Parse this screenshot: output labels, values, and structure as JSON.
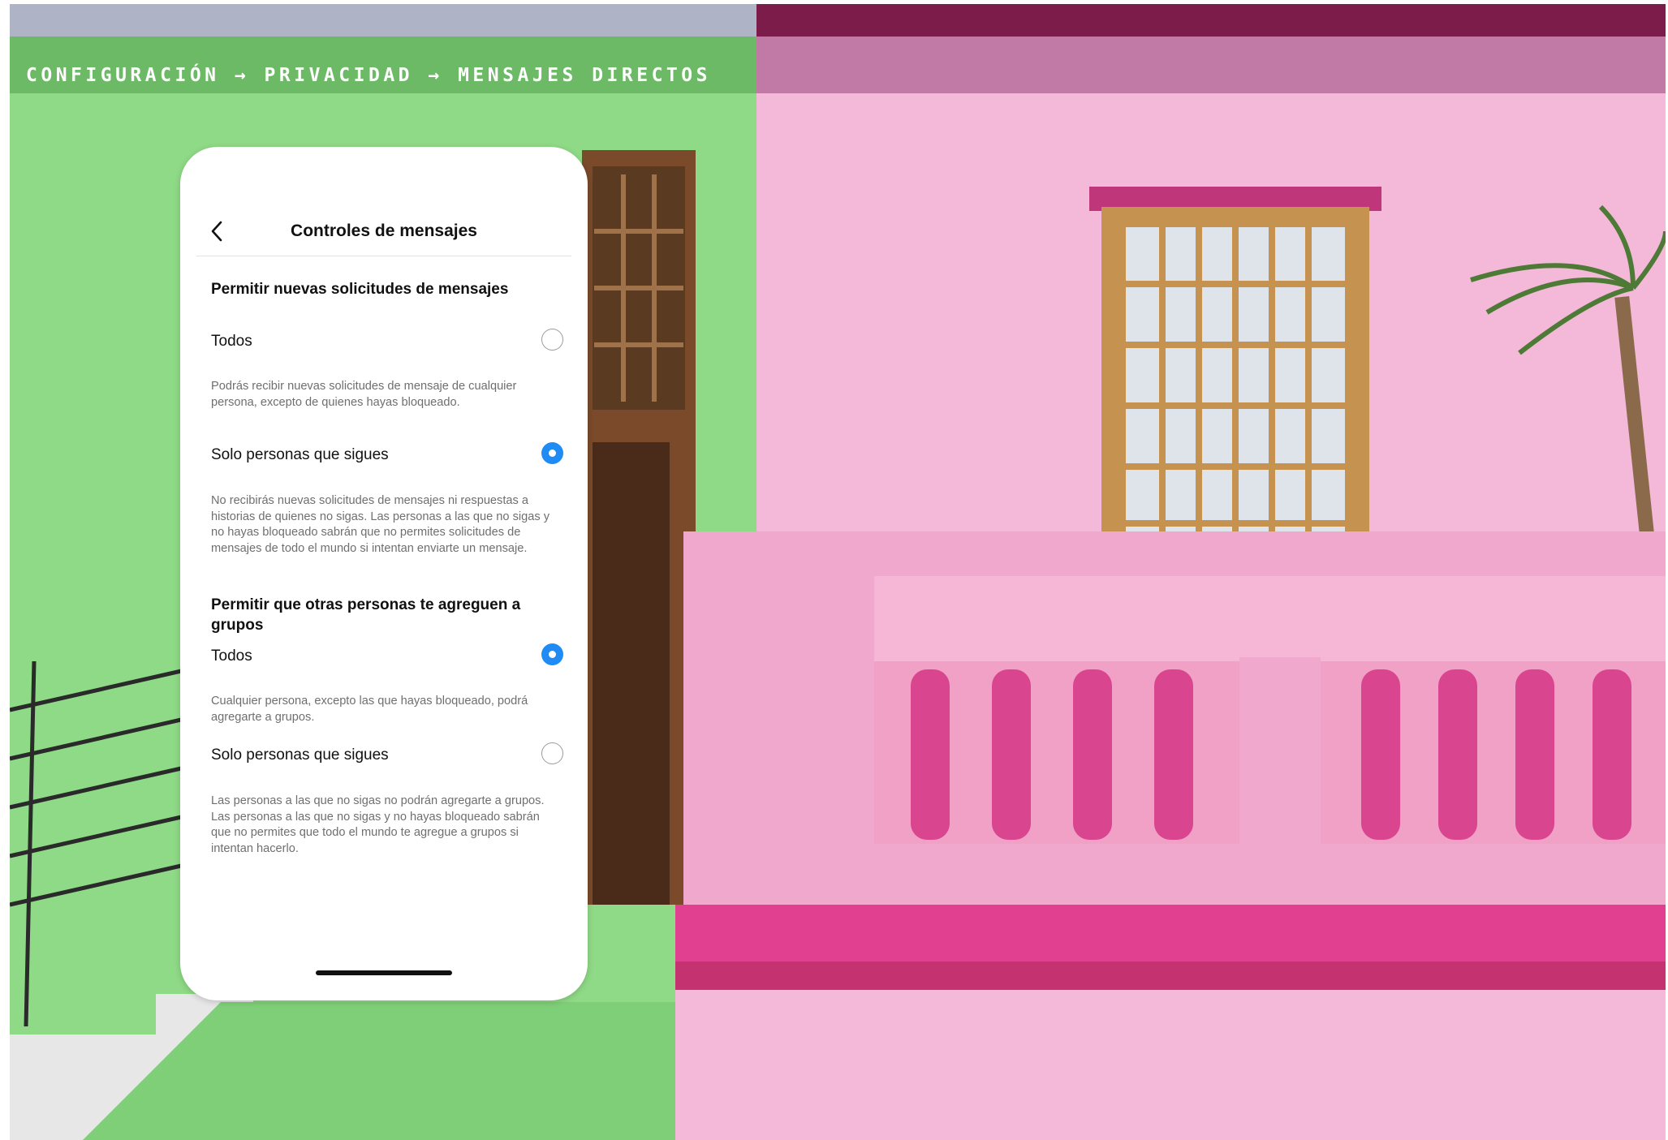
{
  "breadcrumb": {
    "text": "CONFIGURACIÓN → PRIVACIDAD → MENSAJES DIRECTOS"
  },
  "screen": {
    "title": "Controles de mensajes",
    "back_icon": "chevron-left-icon",
    "sections": [
      {
        "title": "Permitir nuevas solicitudes de mensajes",
        "options": [
          {
            "label": "Todos",
            "selected": false,
            "description": "Podrás recibir nuevas solicitudes de mensaje de cualquier persona, excepto de quienes hayas bloqueado."
          },
          {
            "label": "Solo personas que sigues",
            "selected": true,
            "description": "No recibirás nuevas solicitudes de mensajes ni respuestas a historias de quienes no sigas. Las personas a las que no sigas y no hayas bloqueado sabrán que no permites solicitudes de mensajes de todo el mundo si intentan enviarte un mensaje."
          }
        ]
      },
      {
        "title": "Permitir que otras personas te agreguen a grupos",
        "options": [
          {
            "label": "Todos",
            "selected": true,
            "description": "Cualquier persona, excepto las que hayas bloqueado, podrá agregarte a grupos."
          },
          {
            "label": "Solo personas que sigues",
            "selected": false,
            "description": "Las personas a las que no sigas no podrán agregarte a grupos. Las personas a las que no sigas y no hayas bloqueado sabrán que no permites que todo el mundo te agregue a grupos si intentan hacerlo."
          }
        ]
      }
    ]
  },
  "colors": {
    "accent": "#1e8cf4",
    "green_wall": "#8fda86",
    "pink_wall": "#f4b8d9",
    "magenta_trim": "#e0408f"
  }
}
